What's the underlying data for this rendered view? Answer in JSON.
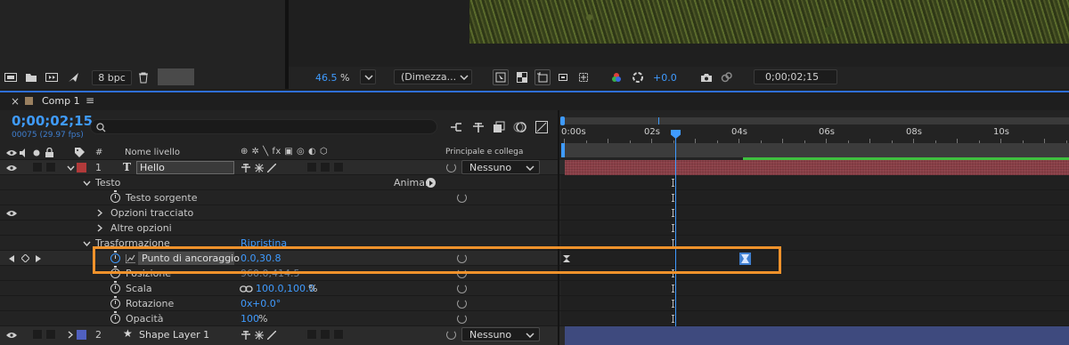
{
  "top": {
    "bpc_label": "8 bpc",
    "zoom_value": "46.5",
    "zoom_unit": "%",
    "resolution_label": "(Dimezza...",
    "exposure_value": "+0.0",
    "current_time": "0;00;02;15"
  },
  "panel": {
    "close_symbol": "×",
    "tab_label": "Comp 1",
    "menu_symbol": "≡",
    "timecode": "0;00;02;15",
    "frames_info": "00075 (29.97 fps)",
    "search_placeholder": ""
  },
  "columns": {
    "hash": "#",
    "layer_name": "Nome livello",
    "switches": "⊕ ✲ ╲ fx ▣ ◎ ◐ ⬡",
    "parent": "Principale e collega"
  },
  "layers": [
    {
      "index": "1",
      "type_glyph": "T",
      "name": "Hello",
      "parent_value": "Nessuno",
      "color": "#b13a3a"
    },
    {
      "index": "2",
      "type_glyph": "★",
      "name": "Shape Layer 1",
      "parent_value": "Nessuno",
      "color": "#5060c0"
    }
  ],
  "properties": {
    "text_group": "Testo",
    "animate_label": "Anima:",
    "source_text": "Testo sorgente",
    "path_options": "Opzioni tracciato",
    "more_options": "Altre opzioni",
    "transform_group": "Trasformazione",
    "reset_label": "Ripristina",
    "anchor_label": "Punto di ancoraggio",
    "anchor_value": "0.0,30.8",
    "position_label": "Posizione",
    "position_value": "960.0,414.5",
    "scale_label": "Scala",
    "scale_value": "100.0,100.0",
    "scale_unit": "%",
    "rotation_label": "Rotazione",
    "rotation_prefix": "0x",
    "rotation_value": "+0.0°",
    "opacity_label": "Opacità",
    "opacity_value": "100",
    "opacity_unit": "%"
  },
  "timeline": {
    "ticks": [
      "0:00s",
      "02s",
      "04s",
      "06s",
      "08s",
      "10s"
    ],
    "playhead_seconds": 2.5
  },
  "colors": {
    "accent_blue": "#3f9bff",
    "highlight_orange": "#f0922b",
    "layer1_bar": "#8a3f47",
    "layer2_bar": "#3e4a7e",
    "work_area_green": "#3fbf3f"
  }
}
